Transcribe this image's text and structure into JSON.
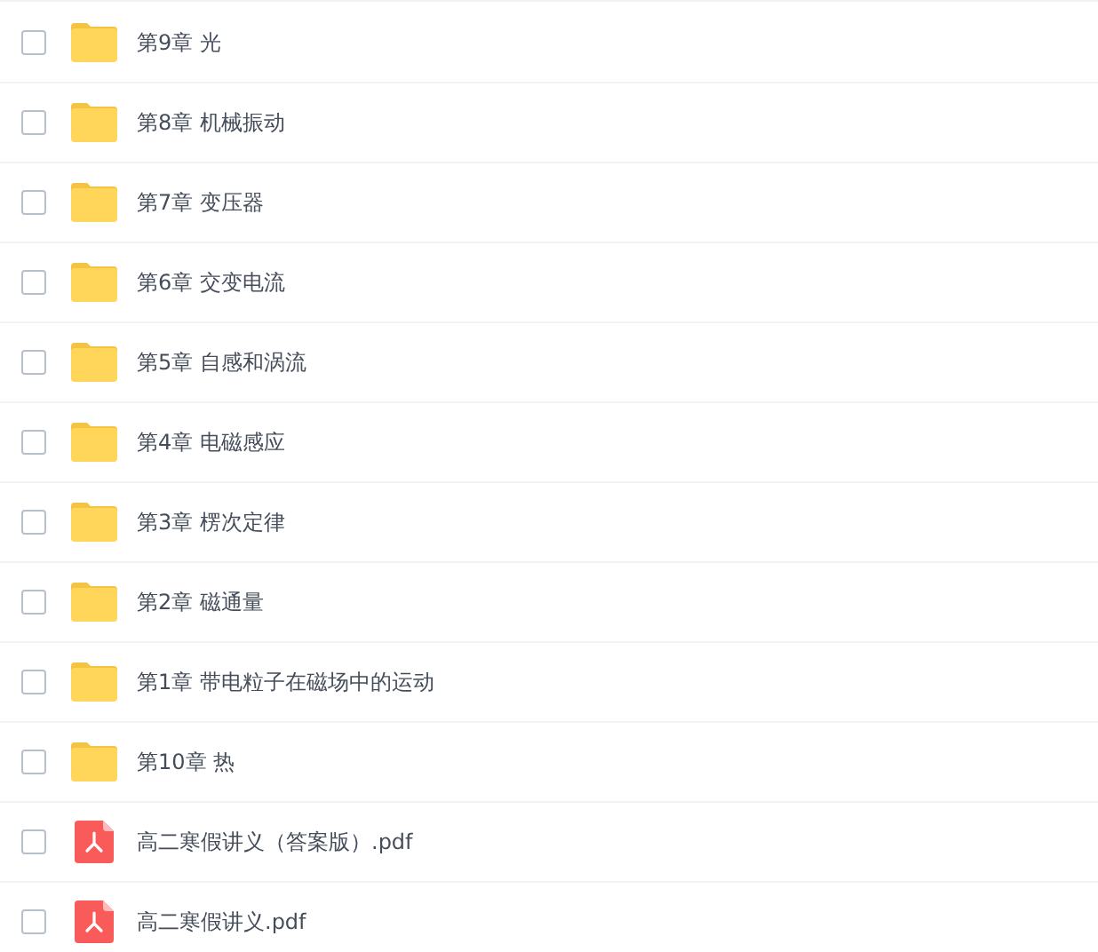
{
  "files": [
    {
      "kind": "folder",
      "name": "第9章 光",
      "checked": false
    },
    {
      "kind": "folder",
      "name": "第8章 机械振动",
      "checked": false
    },
    {
      "kind": "folder",
      "name": "第7章 变压器",
      "checked": false
    },
    {
      "kind": "folder",
      "name": "第6章 交变电流",
      "checked": false
    },
    {
      "kind": "folder",
      "name": "第5章 自感和涡流",
      "checked": false
    },
    {
      "kind": "folder",
      "name": "第4章 电磁感应",
      "checked": false
    },
    {
      "kind": "folder",
      "name": "第3章 楞次定律",
      "checked": false
    },
    {
      "kind": "folder",
      "name": "第2章 磁通量",
      "checked": false
    },
    {
      "kind": "folder",
      "name": "第1章 带电粒子在磁场中的运动",
      "checked": false
    },
    {
      "kind": "folder",
      "name": "第10章 热",
      "checked": false
    },
    {
      "kind": "pdf",
      "name": "高二寒假讲义（答案版）.pdf",
      "checked": false
    },
    {
      "kind": "pdf",
      "name": "高二寒假讲义.pdf",
      "checked": false
    }
  ]
}
